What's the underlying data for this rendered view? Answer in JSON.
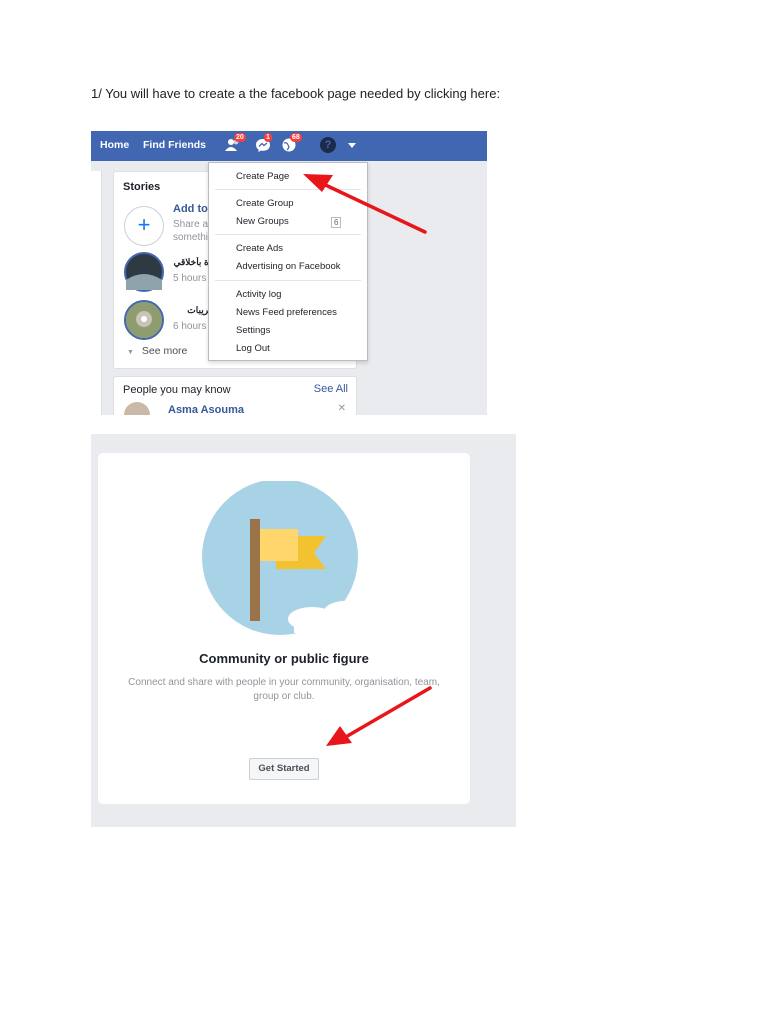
{
  "instruction": "1/ You will have to create a the facebook page needed  by clicking here:",
  "topbar": {
    "home": "Home",
    "find_friends": "Find Friends",
    "friend_requests_badge": "20",
    "messages_badge": "1",
    "notifications_badge": "68",
    "help_glyph": "?"
  },
  "dropdown": {
    "items": [
      "Create Page",
      "Create Group",
      "New Groups",
      "Create Ads",
      "Advertising on Facebook",
      "Activity log",
      "News Feed preferences",
      "Settings",
      "Log Out"
    ],
    "new_groups_count": "6"
  },
  "stories": {
    "title": "Stories",
    "add_label": "Add to",
    "share_text": "Share a somethi",
    "items": [
      {
        "name": "رة بأخلاقي",
        "time": "5 hours"
      },
      {
        "name": "قريبات",
        "time": "6 hours"
      }
    ],
    "see_more": "See more"
  },
  "people": {
    "title": "People you may know",
    "see_all": "See All",
    "person_name": "Asma Asouma"
  },
  "community_card": {
    "title": "Community or public figure",
    "description": "Connect and share with people in your community, organisation, team, group or club.",
    "button": "Get Started"
  },
  "colors": {
    "facebook_blue": "#4267b2",
    "badge_red": "#fa3e3e",
    "arrow_red": "#e8151a",
    "flag_yellow": "#f7c843",
    "circle_blue": "#a8d2e6"
  }
}
